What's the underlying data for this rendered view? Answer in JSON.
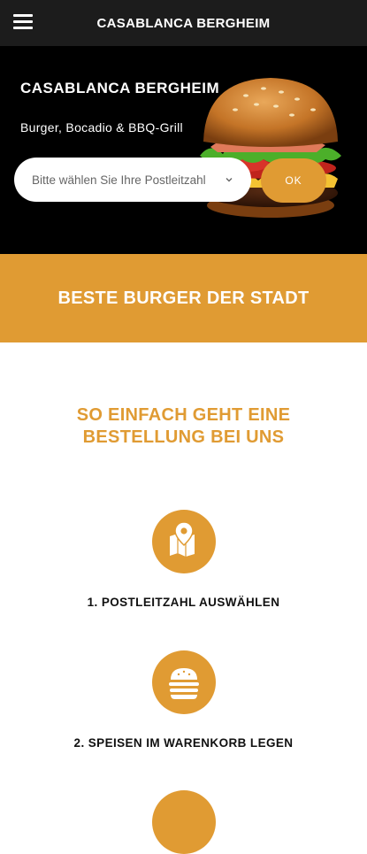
{
  "header": {
    "title": "CASABLANCA BERGHEIM"
  },
  "hero": {
    "title": "CASABLANCA BERGHEIM",
    "subtitle": "Burger, Bocadio & BBQ-Grill",
    "postal_select_placeholder": "Bitte wählen Sie Ihre Postleitzahl",
    "ok_label": "OK"
  },
  "banner": {
    "text": "BESTE BURGER DER STADT"
  },
  "how": {
    "title_line1": "SO EINFACH GEHT EINE",
    "title_line2": "BESTELLUNG BEI UNS",
    "steps": [
      {
        "label": "1. POSTLEITZAHL AUSWÄHLEN",
        "icon": "map-pin-icon"
      },
      {
        "label": "2. SPEISEN IM WARENKORB LEGEN",
        "icon": "burger-icon"
      }
    ]
  },
  "colors": {
    "accent": "#e09b33",
    "topbar": "#1c1c1c",
    "hero_bg": "#000000"
  }
}
